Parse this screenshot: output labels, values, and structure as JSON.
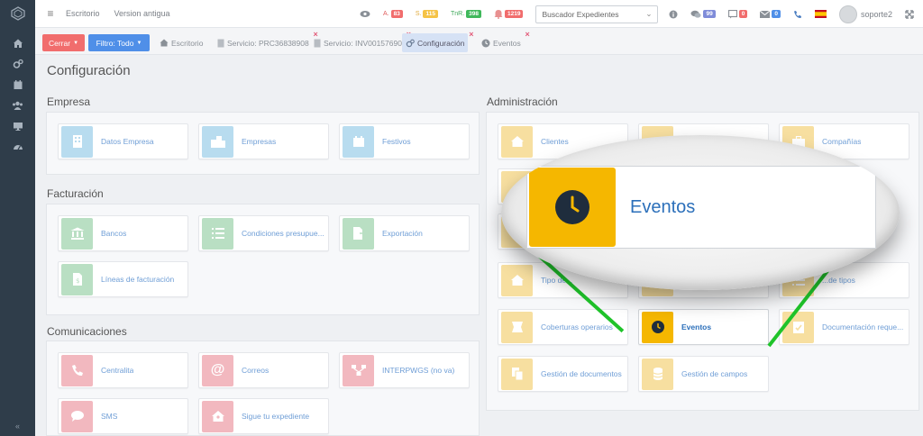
{
  "topbar": {
    "links": [
      "Escritorio",
      "Version antigua"
    ],
    "counters": [
      {
        "prefix": "A.",
        "count": "83",
        "color": "#f16d6d"
      },
      {
        "prefix": "S.",
        "count": "115",
        "color": "#f5c346"
      },
      {
        "prefix": "TnR.",
        "count": "398",
        "color": "#3fb85b"
      },
      {
        "prefix": "",
        "count": "1219",
        "color": "#f16d6d"
      }
    ],
    "search_placeholder": "Buscador Expedientes",
    "chat_count": "99",
    "msg_count": "0",
    "mail_count": "0",
    "username": "soporte2"
  },
  "tabbar": {
    "cerrar_label": "Cerrar",
    "filtro_label": "Filtro: Todo",
    "tabs": [
      {
        "label": "Escritorio"
      },
      {
        "label": "Servicio: PRC36838908"
      },
      {
        "label": "Servicio: INV00157690"
      },
      {
        "label": "Configuración"
      },
      {
        "label": "Eventos"
      }
    ]
  },
  "page": {
    "title": "Configuración",
    "sections": {
      "empresa": {
        "title": "Empresa",
        "items": [
          "Datos Empresa",
          "Empresas",
          "Festivos"
        ]
      },
      "facturacion": {
        "title": "Facturación",
        "items": [
          "Bancos",
          "Condiciones presupue...",
          "Exportación",
          "Líneas de facturación"
        ]
      },
      "comunicaciones": {
        "title": "Comunicaciones",
        "items": [
          "Centralita",
          "Correos",
          "INTERPWGS (no va)",
          "SMS",
          "Sigue tu expediente"
        ]
      },
      "administracion": {
        "title": "Administración",
        "items": [
          "Clientes",
          "Compañías",
          "Tipo de...",
          "...de tipos",
          "Coberturas operarios",
          "Eventos",
          "Documentación reque...",
          "Gestión de documentos",
          "Gestión de campos"
        ]
      }
    }
  },
  "magnifier": {
    "label": "Eventos"
  },
  "colors": {
    "accent_red": "#f16d6d",
    "accent_blue": "#4f8fe8",
    "highlight_yellow": "#f5b700",
    "green_line": "#1fc32a"
  }
}
